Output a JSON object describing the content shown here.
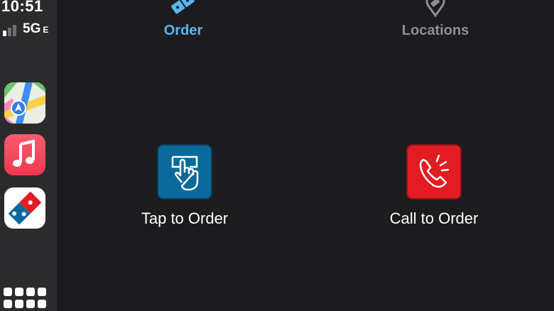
{
  "status_bar": {
    "time": "10:51",
    "network": "5G",
    "network_suffix": "E",
    "signal_bars_active": 1,
    "signal_bars_total": 4
  },
  "dock": {
    "apps": [
      {
        "name": "Maps",
        "icon": "maps-icon"
      },
      {
        "name": "Music",
        "icon": "music-icon"
      },
      {
        "name": "Domino's",
        "icon": "dominos-icon"
      }
    ],
    "home_button_icon": "app-grid-icon"
  },
  "tabs": {
    "order": {
      "label": "Order",
      "icon": "domino-tile-icon",
      "active": true
    },
    "locations": {
      "label": "Locations",
      "icon": "location-pin-icon",
      "active": false
    }
  },
  "actions": {
    "tap_to_order": {
      "label": "Tap to Order",
      "icon": "hand-tap-icon"
    },
    "call_to_order": {
      "label": "Call to Order",
      "icon": "phone-ringing-icon"
    }
  },
  "colors": {
    "background": "#1c1c1e",
    "dock": "#2b2b2d",
    "active_tab": "#5ab5f0",
    "inactive_tab": "#8e8e93",
    "tap_tile": "#0a6a9c",
    "call_tile": "#e31b23"
  }
}
